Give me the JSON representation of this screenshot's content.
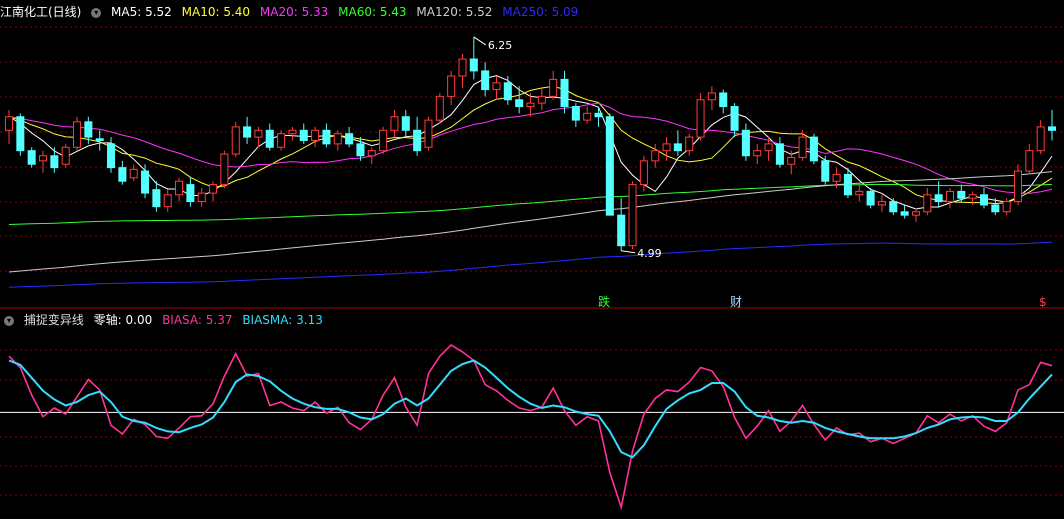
{
  "colors": {
    "up": "#ff3c3c",
    "down": "#54ffff",
    "ma5": "#ffffff",
    "ma10": "#ffff33",
    "ma20": "#ff33ff",
    "ma60": "#33ff33",
    "ma120": "#cccccc",
    "ma250": "#2a2aff",
    "biasa": "#ff3399",
    "biasma": "#33ddff",
    "grid": "#8a0000"
  },
  "upper": {
    "stock_title": "江南化工(日线)",
    "ma_legend": [
      {
        "key": "ma5",
        "text": "MA5: 5.52"
      },
      {
        "key": "ma10",
        "text": "MA10: 5.40"
      },
      {
        "key": "ma20",
        "text": "MA20: 5.33"
      },
      {
        "key": "ma60",
        "text": "MA60: 5.43"
      },
      {
        "key": "ma120",
        "text": "MA120: 5.52"
      },
      {
        "key": "ma250",
        "text": "MA250: 5.09"
      }
    ],
    "high_label": "6.25",
    "low_label": "4.99",
    "event_markers": [
      "跌",
      "财",
      "$"
    ]
  },
  "lower": {
    "indicator_name": "捕捉变异线",
    "zero_axis_label": "零轴: 0.00",
    "biasa_label": "BIASA: 5.37",
    "biasma_label": "BIASMA: 3.13"
  },
  "chart_data": [
    {
      "type": "candlestick",
      "title": "江南化工(日线)",
      "price_range": [
        4.7,
        6.35
      ],
      "candles": [
        [
          5.7,
          5.82,
          5.62,
          5.78
        ],
        [
          5.78,
          5.8,
          5.55,
          5.58
        ],
        [
          5.58,
          5.6,
          5.48,
          5.5
        ],
        [
          5.52,
          5.58,
          5.45,
          5.55
        ],
        [
          5.55,
          5.6,
          5.45,
          5.48
        ],
        [
          5.5,
          5.62,
          5.48,
          5.6
        ],
        [
          5.6,
          5.78,
          5.58,
          5.75
        ],
        [
          5.75,
          5.78,
          5.62,
          5.66
        ],
        [
          5.65,
          5.7,
          5.58,
          5.64
        ],
        [
          5.62,
          5.66,
          5.45,
          5.48
        ],
        [
          5.48,
          5.52,
          5.38,
          5.4
        ],
        [
          5.42,
          5.5,
          5.4,
          5.47
        ],
        [
          5.46,
          5.5,
          5.3,
          5.33
        ],
        [
          5.35,
          5.4,
          5.22,
          5.25
        ],
        [
          5.25,
          5.35,
          5.22,
          5.32
        ],
        [
          5.32,
          5.42,
          5.28,
          5.4
        ],
        [
          5.38,
          5.42,
          5.25,
          5.28
        ],
        [
          5.28,
          5.36,
          5.25,
          5.33
        ],
        [
          5.33,
          5.4,
          5.28,
          5.38
        ],
        [
          5.38,
          5.58,
          5.36,
          5.56
        ],
        [
          5.56,
          5.75,
          5.54,
          5.72
        ],
        [
          5.72,
          5.78,
          5.62,
          5.66
        ],
        [
          5.66,
          5.72,
          5.6,
          5.7
        ],
        [
          5.7,
          5.74,
          5.58,
          5.6
        ],
        [
          5.6,
          5.7,
          5.58,
          5.68
        ],
        [
          5.68,
          5.72,
          5.64,
          5.7
        ],
        [
          5.7,
          5.74,
          5.62,
          5.64
        ],
        [
          5.64,
          5.72,
          5.6,
          5.7
        ],
        [
          5.7,
          5.74,
          5.6,
          5.62
        ],
        [
          5.62,
          5.7,
          5.58,
          5.68
        ],
        [
          5.68,
          5.72,
          5.6,
          5.62
        ],
        [
          5.62,
          5.66,
          5.52,
          5.55
        ],
        [
          5.55,
          5.6,
          5.5,
          5.58
        ],
        [
          5.58,
          5.72,
          5.56,
          5.7
        ],
        [
          5.7,
          5.82,
          5.66,
          5.78
        ],
        [
          5.78,
          5.82,
          5.66,
          5.7
        ],
        [
          5.7,
          5.78,
          5.55,
          5.58
        ],
        [
          5.6,
          5.78,
          5.58,
          5.76
        ],
        [
          5.76,
          5.92,
          5.74,
          5.9
        ],
        [
          5.9,
          6.05,
          5.85,
          6.02
        ],
        [
          6.02,
          6.15,
          5.95,
          6.12
        ],
        [
          6.12,
          6.25,
          6.0,
          6.05
        ],
        [
          6.05,
          6.1,
          5.9,
          5.94
        ],
        [
          5.94,
          6.02,
          5.88,
          5.98
        ],
        [
          5.98,
          6.02,
          5.85,
          5.88
        ],
        [
          5.88,
          5.96,
          5.8,
          5.84
        ],
        [
          5.84,
          5.92,
          5.78,
          5.86
        ],
        [
          5.86,
          5.95,
          5.82,
          5.9
        ],
        [
          5.9,
          6.05,
          5.88,
          6.0
        ],
        [
          6.0,
          6.05,
          5.8,
          5.84
        ],
        [
          5.84,
          5.86,
          5.72,
          5.76
        ],
        [
          5.76,
          5.84,
          5.74,
          5.8
        ],
        [
          5.8,
          5.84,
          5.72,
          5.78
        ],
        [
          5.78,
          5.8,
          5.5,
          5.2
        ],
        [
          5.2,
          5.3,
          4.99,
          5.02
        ],
        [
          5.02,
          5.4,
          5.0,
          5.38
        ],
        [
          5.38,
          5.55,
          5.34,
          5.52
        ],
        [
          5.52,
          5.62,
          5.48,
          5.58
        ],
        [
          5.58,
          5.66,
          5.52,
          5.62
        ],
        [
          5.62,
          5.7,
          5.55,
          5.58
        ],
        [
          5.58,
          5.68,
          5.55,
          5.66
        ],
        [
          5.66,
          5.92,
          5.64,
          5.88
        ],
        [
          5.88,
          5.96,
          5.82,
          5.92
        ],
        [
          5.92,
          5.94,
          5.8,
          5.84
        ],
        [
          5.84,
          5.86,
          5.66,
          5.7
        ],
        [
          5.7,
          5.74,
          5.52,
          5.55
        ],
        [
          5.55,
          5.62,
          5.5,
          5.58
        ],
        [
          5.58,
          5.66,
          5.52,
          5.62
        ],
        [
          5.62,
          5.66,
          5.48,
          5.5
        ],
        [
          5.5,
          5.58,
          5.44,
          5.54
        ],
        [
          5.54,
          5.7,
          5.52,
          5.66
        ],
        [
          5.66,
          5.68,
          5.5,
          5.52
        ],
        [
          5.52,
          5.55,
          5.38,
          5.4
        ],
        [
          5.4,
          5.48,
          5.36,
          5.44
        ],
        [
          5.44,
          5.48,
          5.3,
          5.32
        ],
        [
          5.32,
          5.38,
          5.28,
          5.34
        ],
        [
          5.34,
          5.36,
          5.24,
          5.26
        ],
        [
          5.26,
          5.32,
          5.22,
          5.28
        ],
        [
          5.28,
          5.3,
          5.2,
          5.22
        ],
        [
          5.22,
          5.26,
          5.18,
          5.2
        ],
        [
          5.2,
          5.24,
          5.16,
          5.22
        ],
        [
          5.22,
          5.36,
          5.2,
          5.32
        ],
        [
          5.32,
          5.4,
          5.25,
          5.28
        ],
        [
          5.28,
          5.36,
          5.24,
          5.34
        ],
        [
          5.34,
          5.38,
          5.28,
          5.3
        ],
        [
          5.3,
          5.34,
          5.26,
          5.32
        ],
        [
          5.32,
          5.36,
          5.24,
          5.26
        ],
        [
          5.26,
          5.3,
          5.2,
          5.22
        ],
        [
          5.22,
          5.3,
          5.2,
          5.28
        ],
        [
          5.28,
          5.5,
          5.26,
          5.46
        ],
        [
          5.46,
          5.62,
          5.44,
          5.58
        ],
        [
          5.58,
          5.76,
          5.56,
          5.72
        ],
        [
          5.72,
          5.82,
          5.64,
          5.7
        ]
      ]
    },
    {
      "type": "line",
      "title": "捕捉变异线",
      "y_zero": 0,
      "ylim": [
        -12,
        10
      ],
      "series": [
        {
          "name": "BIASA",
          "values": [
            6.5,
            5.2,
            2.0,
            -0.5,
            0.5,
            -0.2,
            1.8,
            3.8,
            2.6,
            -1.5,
            -2.5,
            -0.8,
            -1.4,
            -2.8,
            -3.0,
            -1.8,
            -0.5,
            -0.4,
            1.0,
            4.2,
            6.8,
            4.2,
            4.5,
            0.8,
            1.2,
            0.5,
            0.2,
            1.2,
            -0.1,
            0.6,
            -1.2,
            -2.0,
            -0.8,
            2.0,
            4.0,
            0.6,
            -1.5,
            4.5,
            6.5,
            7.8,
            7.0,
            6.0,
            3.2,
            2.5,
            1.4,
            0.5,
            0.2,
            0.6,
            2.8,
            0.2,
            -1.5,
            -0.5,
            -1.0,
            -7.0,
            -11.0,
            -4.5,
            -0.2,
            1.6,
            2.6,
            2.4,
            3.5,
            5.2,
            4.8,
            3.0,
            -0.6,
            -3.0,
            -1.6,
            0.2,
            -2.2,
            -1.0,
            0.8,
            -1.4,
            -3.2,
            -1.8,
            -2.6,
            -2.4,
            -3.4,
            -3.0,
            -3.6,
            -3.0,
            -2.4,
            -0.4,
            -1.2,
            -0.2,
            -1.0,
            -0.4,
            -1.6,
            -2.2,
            -1.2,
            2.6,
            3.2,
            5.8,
            5.4
          ]
        },
        {
          "name": "BIASMA",
          "values": [
            6.0,
            5.5,
            4.0,
            2.5,
            1.5,
            0.8,
            1.2,
            2.0,
            2.4,
            1.2,
            -0.5,
            -1.0,
            -1.2,
            -1.8,
            -2.2,
            -2.3,
            -1.8,
            -1.4,
            -0.6,
            1.2,
            3.5,
            4.4,
            4.2,
            3.6,
            2.5,
            1.6,
            1.0,
            0.6,
            0.4,
            0.4,
            0.0,
            -0.6,
            -0.8,
            -0.2,
            1.0,
            1.6,
            0.8,
            1.6,
            3.2,
            4.8,
            5.6,
            6.0,
            5.2,
            4.0,
            2.8,
            1.8,
            1.0,
            0.5,
            0.8,
            0.6,
            0.1,
            -0.2,
            -0.4,
            -2.2,
            -4.6,
            -5.2,
            -3.8,
            -1.6,
            0.4,
            1.4,
            2.2,
            2.6,
            3.4,
            3.4,
            2.4,
            0.6,
            -0.4,
            -0.6,
            -1.0,
            -1.2,
            -1.0,
            -1.2,
            -1.8,
            -2.2,
            -2.5,
            -2.8,
            -3.0,
            -3.0,
            -3.0,
            -2.8,
            -2.4,
            -1.8,
            -1.4,
            -0.8,
            -0.6,
            -0.5,
            -0.6,
            -1.0,
            -1.0,
            0.0,
            1.6,
            3.0,
            4.4
          ]
        }
      ]
    }
  ]
}
